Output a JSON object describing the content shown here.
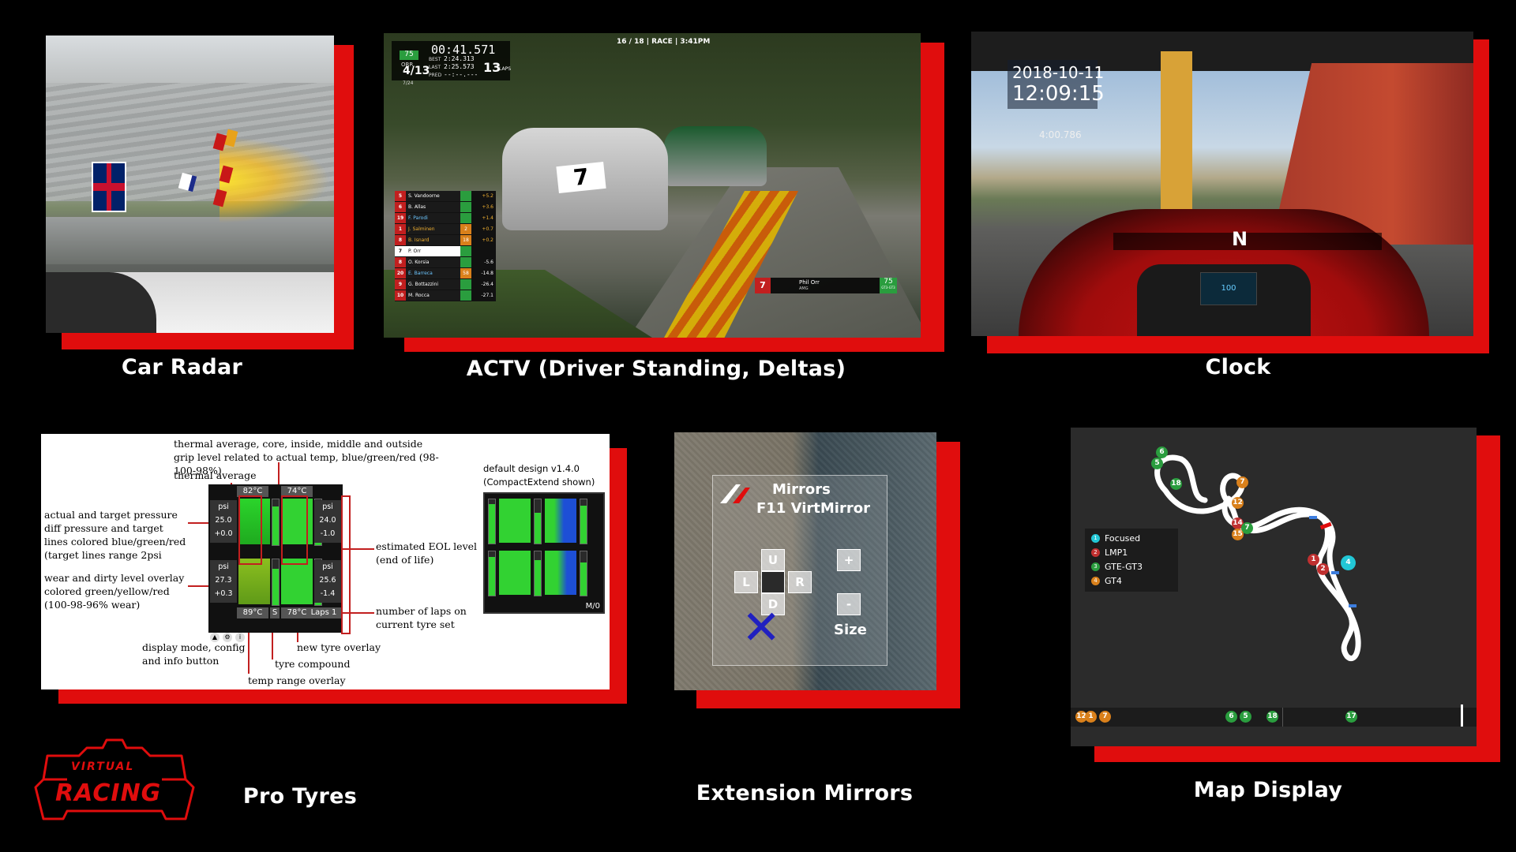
{
  "captions": {
    "car_radar": "Car Radar",
    "actv": "ACTV (Driver Standing, Deltas)",
    "clock": "Clock",
    "pro_tyres": "Pro Tyres",
    "extension_mirrors": "Extension Mirrors",
    "map_display": "Map Display"
  },
  "brand": {
    "line1": "VIRTUAL",
    "line2": "RACING"
  },
  "colors": {
    "accent": "#e00d0d",
    "background": "#000000",
    "green": "#2a9d3e",
    "cyan": "#22c7d6",
    "orange": "#d9801b"
  },
  "actv": {
    "lap_info": "16 / 18 | RACE | 3:41PM",
    "badge": "75",
    "team": "ORR",
    "timer": "00:41.571",
    "position": "4/13",
    "position_sub": "7/24",
    "best_label": "BEST",
    "best_value": "2:24.313",
    "last_label": "LAST",
    "last_value": "2:25.573",
    "pred_label": "PRED",
    "pred_value": "--:--.---",
    "laps": "13",
    "laps_label": "LAPS",
    "car_number": "7",
    "standings": [
      {
        "pos": "5",
        "name": "S. Vandoorne",
        "gap": "",
        "delta": "+5.2"
      },
      {
        "pos": "6",
        "name": "B. Allas",
        "gap": "",
        "delta": "+3.6"
      },
      {
        "pos": "19",
        "name": "F. Parodi",
        "gap": "",
        "delta": "+1.4"
      },
      {
        "pos": "1",
        "name": "J. Salminen",
        "gap": "2",
        "delta": "+0.7"
      },
      {
        "pos": "8",
        "name": "B. Isnard",
        "gap": "18",
        "delta": "+0.2"
      },
      {
        "pos": "7",
        "name": "P. Orr",
        "gap": "",
        "delta": ""
      },
      {
        "pos": "8",
        "name": "O. Korsia",
        "gap": "",
        "delta": "-5.6"
      },
      {
        "pos": "20",
        "name": "E. Barreca",
        "gap": "58",
        "delta": "-14.8"
      },
      {
        "pos": "9",
        "name": "G. Bottazzini",
        "gap": "",
        "delta": "-26.4"
      },
      {
        "pos": "10",
        "name": "M. Rocca",
        "gap": "",
        "delta": "-27.1"
      }
    ],
    "driver_tag": {
      "pos": "7",
      "name": "Phil Orr",
      "car": "AMG",
      "number": "75",
      "class": "GT3-GT3"
    }
  },
  "clock": {
    "date": "2018-10-11",
    "time": "12:09:15",
    "laptime": "4:00.786",
    "gear": "N",
    "speed": "100"
  },
  "tyres": {
    "annotations": {
      "thermal_grip": "thermal  average, core, inside, middle and outside grip level related to actual temp, blue/green/red (98-100-98%)",
      "thermal_average": "thermal average",
      "pressure": "actual and target pressure diff pressure and target lines colored blue/green/red (target lines range 2psi",
      "wear": "wear and dirty level overlay colored green/yellow/red (100-98-96% wear)",
      "display_mode": "display mode, config and info button",
      "temp_range": "temp range overlay",
      "compound": "tyre compound",
      "new_tyre": "new tyre overlay",
      "laps": "number of laps on current tyre set",
      "eol": "estimated EOL level (end of life)",
      "default_design": "default design v1.4.0 (CompactExtend shown)"
    },
    "widget": {
      "temp_fl": "82°C",
      "temp_fr": "74°C",
      "temp_rl": "89°C",
      "temp_rr": "78°C",
      "compound": "S",
      "laps": "Laps 1",
      "psi_label": "psi",
      "psi_fl": "25.0",
      "diff_fl": "+0.0",
      "psi_fr": "24.0",
      "diff_fr": "-1.0",
      "psi_rl": "27.3",
      "diff_rl": "+0.3",
      "psi_rr": "25.6",
      "diff_rr": "-1.4",
      "default_tag": "M/0"
    }
  },
  "mirrors": {
    "title": "Mirrors",
    "subtitle": "F11 VirtMirror",
    "key_up": "U",
    "key_left": "L",
    "key_right": "R",
    "key_down": "D",
    "plus": "+",
    "minus": "-",
    "size": "Size"
  },
  "map": {
    "legend": [
      {
        "num": "1",
        "label": "Focused",
        "color": "#22c7d6"
      },
      {
        "num": "2",
        "label": "LMP1",
        "color": "#c03030"
      },
      {
        "num": "3",
        "label": "GTE-GT3",
        "color": "#2a9d3e"
      },
      {
        "num": "4",
        "label": "GT4",
        "color": "#d9801b"
      }
    ]
  }
}
